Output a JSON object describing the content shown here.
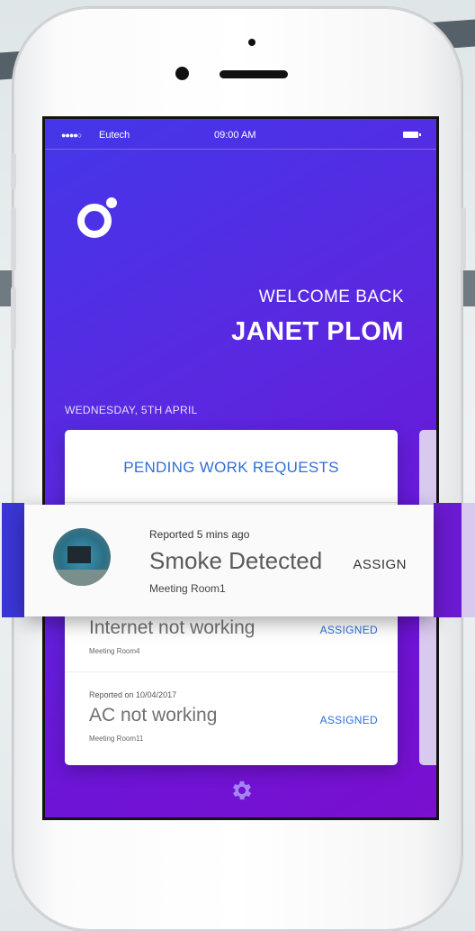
{
  "status_bar": {
    "signal": "●●●●○",
    "carrier": "Eutech",
    "time": "09:00 AM"
  },
  "welcome": {
    "greeting": "WELCOME BACK",
    "name": "JANET PLOM"
  },
  "date": "WEDNESDAY, 5TH APRIL",
  "card": {
    "title": "PENDING WORK REQUESTS"
  },
  "highlighted_request": {
    "reported": "Reported 5 mins ago",
    "title": "Smoke Detected",
    "location": "Meeting Room1",
    "action": "ASSIGN"
  },
  "requests": [
    {
      "reported": "",
      "title": "Internet not working",
      "location": "Meeting Room4",
      "status": "ASSIGNED"
    },
    {
      "reported": "Reported on 10/04/2017",
      "title": "AC not working",
      "location": "Meeting Room11",
      "status": "ASSIGNED"
    }
  ],
  "icons": {
    "logo": "app-logo-icon",
    "settings": "gear-icon",
    "battery": "battery-icon"
  },
  "colors": {
    "gradient_start": "#4437e9",
    "gradient_end": "#7a0fce",
    "accent_blue": "#2f6fd8",
    "next_card": "#d8c9ee"
  }
}
